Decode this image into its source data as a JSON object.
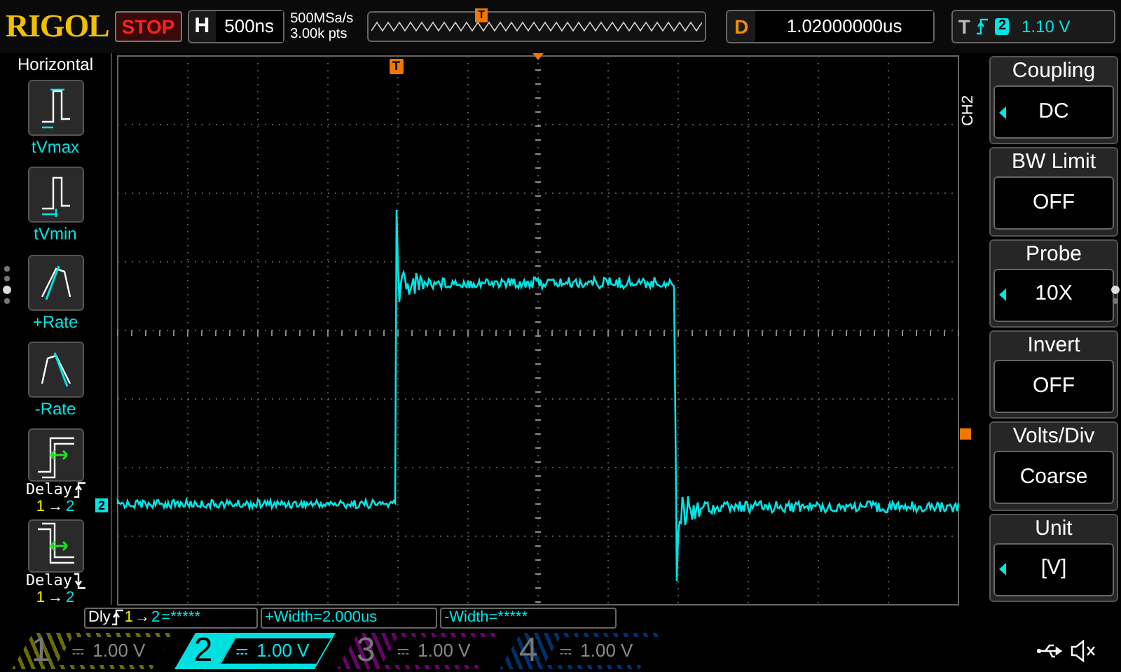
{
  "brand": "RIGOL",
  "run_state": {
    "label": "STOP",
    "running": false
  },
  "horizontal": {
    "label": "H",
    "timebase": "500ns",
    "sample_rate": "500MSa/s",
    "memory_depth": "3.00k pts"
  },
  "trigger_position": {
    "label": "T"
  },
  "delay": {
    "label": "D",
    "value": "1.02000000us"
  },
  "trigger": {
    "label": "T",
    "source": "2",
    "level": "1.10 V"
  },
  "side_menu": {
    "title": "Horizontal",
    "items": [
      {
        "kind": "measure",
        "label": "tVmax"
      },
      {
        "kind": "measure",
        "label": "tVmin"
      },
      {
        "kind": "measure",
        "label": "+Rate"
      },
      {
        "kind": "measure",
        "label": "-Rate"
      },
      {
        "kind": "delay",
        "label": "Delay",
        "rising_edge": true,
        "from": "1",
        "arrow": "→",
        "to": "2"
      },
      {
        "kind": "delay",
        "label": "Delay",
        "rising_edge": false,
        "from": "1",
        "arrow": "→",
        "to": "2"
      }
    ],
    "pages": [
      {
        "selected": false
      },
      {
        "selected": false
      },
      {
        "selected": true
      },
      {
        "selected": false
      }
    ]
  },
  "trigger_time_marker": {
    "label": "T"
  },
  "channel_marker": {
    "label": "2"
  },
  "channel_menu": {
    "channel": "CH2",
    "items": [
      {
        "title": "Coupling",
        "value": "DC",
        "adjustable": true
      },
      {
        "title": "BW Limit",
        "value": "OFF",
        "adjustable": false
      },
      {
        "title": "Probe",
        "value": "10X",
        "adjustable": true
      },
      {
        "title": "Invert",
        "value": "OFF",
        "adjustable": false
      },
      {
        "title": "Volts/Div",
        "value": "Coarse",
        "adjustable": false
      },
      {
        "title": "Unit",
        "value": "[V]",
        "adjustable": true
      }
    ],
    "pages": [
      {
        "selected": true
      },
      {
        "selected": false
      }
    ]
  },
  "measurements": [
    {
      "kind": "delay",
      "prefix": "Dly",
      "from": "1",
      "arrow": "→",
      "to": "2",
      "value": "=*****"
    },
    {
      "kind": "plain",
      "text": "+Width=2.000us"
    },
    {
      "kind": "plain",
      "text": "-Width=*****"
    }
  ],
  "channels": [
    {
      "number": "1",
      "scale": "1.00 V",
      "selected": false,
      "color": "#6b6b00"
    },
    {
      "number": "2",
      "scale": "1.00 V",
      "selected": true,
      "color": "#00e0e0"
    },
    {
      "number": "3",
      "scale": "1.00 V",
      "selected": false,
      "color": "#6b006b"
    },
    {
      "number": "4",
      "scale": "1.00 V",
      "selected": false,
      "color": "#00306b"
    }
  ]
}
